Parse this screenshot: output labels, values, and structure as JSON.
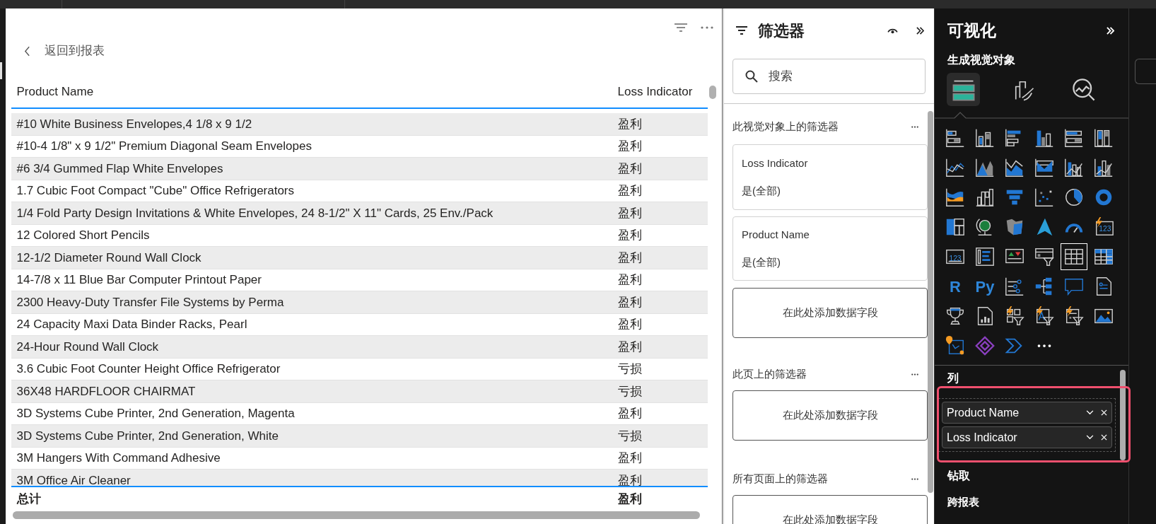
{
  "report": {
    "back_label": "返回到报表",
    "columns": [
      "Product Name",
      "Loss Indicator"
    ],
    "rows": [
      {
        "product": "#10 White Business Envelopes,4 1/8 x 9 1/2",
        "indicator": "盈利"
      },
      {
        "product": "#10-4 1/8\" x 9 1/2\" Premium Diagonal Seam Envelopes",
        "indicator": "盈利"
      },
      {
        "product": "#6 3/4 Gummed Flap White Envelopes",
        "indicator": "盈利"
      },
      {
        "product": "1.7 Cubic Foot Compact \"Cube\" Office Refrigerators",
        "indicator": "盈利"
      },
      {
        "product": "1/4 Fold Party Design Invitations & White Envelopes, 24 8-1/2\" X 11\" Cards, 25 Env./Pack",
        "indicator": "盈利"
      },
      {
        "product": "12 Colored Short Pencils",
        "indicator": "盈利"
      },
      {
        "product": "12-1/2 Diameter Round Wall Clock",
        "indicator": "盈利"
      },
      {
        "product": "14-7/8 x 11 Blue Bar Computer Printout Paper",
        "indicator": "盈利"
      },
      {
        "product": "2300 Heavy-Duty Transfer File Systems by Perma",
        "indicator": "盈利"
      },
      {
        "product": "24 Capacity Maxi Data Binder Racks, Pearl",
        "indicator": "盈利"
      },
      {
        "product": "24-Hour Round Wall Clock",
        "indicator": "盈利"
      },
      {
        "product": "3.6 Cubic Foot Counter Height Office Refrigerator",
        "indicator": "亏损"
      },
      {
        "product": "36X48 HARDFLOOR CHAIRMAT",
        "indicator": "亏损"
      },
      {
        "product": "3D Systems Cube Printer, 2nd Generation, Magenta",
        "indicator": "盈利"
      },
      {
        "product": "3D Systems Cube Printer, 2nd Generation, White",
        "indicator": "亏损"
      },
      {
        "product": "3M Hangers With Command Adhesive",
        "indicator": "盈利"
      },
      {
        "product": "3M Office Air Cleaner",
        "indicator": "盈利"
      }
    ],
    "total": {
      "label": "总计",
      "value": "盈利"
    }
  },
  "filters": {
    "title": "筛选器",
    "search": {
      "placeholder": "搜索"
    },
    "sections": [
      {
        "title": "此视觉对象上的筛选器",
        "cards": [
          {
            "field": "Loss Indicator",
            "value": "是(全部)"
          },
          {
            "field": "Product Name",
            "value": "是(全部)"
          }
        ],
        "add_label": "在此处添加数据字段"
      },
      {
        "title": "此页上的筛选器",
        "add_label": "在此处添加数据字段"
      },
      {
        "title": "所有页面上的筛选器",
        "add_label": "在此处添加数据字段"
      }
    ]
  },
  "visualizations": {
    "title": "可视化",
    "subtitle": "生成视觉对象",
    "tabs": [
      {
        "kind": "build",
        "selected": true
      },
      {
        "kind": "format",
        "selected": false
      },
      {
        "kind": "analytics",
        "selected": false
      }
    ],
    "gallery": [
      {
        "kind": "stacked-bar",
        "selected": false
      },
      {
        "kind": "stacked-column",
        "selected": false
      },
      {
        "kind": "clustered-bar",
        "selected": false
      },
      {
        "kind": "clustered-column",
        "selected": false
      },
      {
        "kind": "percent-bar",
        "selected": false
      },
      {
        "kind": "percent-column",
        "selected": false
      },
      {
        "kind": "line",
        "selected": false
      },
      {
        "kind": "area",
        "selected": false
      },
      {
        "kind": "stacked-area",
        "selected": false
      },
      {
        "kind": "ribbon-area",
        "selected": false
      },
      {
        "kind": "line-column",
        "selected": false
      },
      {
        "kind": "line-stacked-column",
        "selected": false
      },
      {
        "kind": "ribbon",
        "selected": false
      },
      {
        "kind": "waterfall",
        "selected": false
      },
      {
        "kind": "funnel",
        "selected": false
      },
      {
        "kind": "scatter",
        "selected": false
      },
      {
        "kind": "pie",
        "selected": false
      },
      {
        "kind": "donut",
        "selected": false
      },
      {
        "kind": "treemap",
        "selected": false
      },
      {
        "kind": "globe",
        "selected": false
      },
      {
        "kind": "filled-map",
        "selected": false
      },
      {
        "kind": "arrow",
        "selected": false
      },
      {
        "kind": "gauge",
        "selected": false
      },
      {
        "kind": "card-bolt",
        "glyph": "123",
        "selected": false
      },
      {
        "kind": "card",
        "glyph": "123",
        "selected": false
      },
      {
        "kind": "multi-card",
        "selected": false
      },
      {
        "kind": "kpi",
        "selected": false
      },
      {
        "kind": "slicer",
        "selected": false
      },
      {
        "kind": "table",
        "selected": true
      },
      {
        "kind": "matrix",
        "selected": false
      },
      {
        "kind": "script",
        "glyph": "R",
        "selected": false
      },
      {
        "kind": "script",
        "glyph": "Py",
        "selected": false
      },
      {
        "kind": "influencers",
        "selected": false
      },
      {
        "kind": "decomposition",
        "selected": false
      },
      {
        "kind": "qa",
        "selected": false
      },
      {
        "kind": "narrative",
        "selected": false
      },
      {
        "kind": "trophy",
        "selected": false
      },
      {
        "kind": "paginated",
        "selected": false
      },
      {
        "kind": "bolt-slicer",
        "selected": false
      },
      {
        "kind": "bolt-text-slicer",
        "selected": false
      },
      {
        "kind": "bolt-list-slicer",
        "selected": false
      },
      {
        "kind": "image",
        "selected": false
      },
      {
        "kind": "pin-map",
        "selected": false
      },
      {
        "kind": "apps",
        "selected": false
      },
      {
        "kind": "automate",
        "selected": false
      },
      {
        "kind": "more",
        "selected": false
      }
    ],
    "columns_well": {
      "title": "列",
      "fields": [
        "Product Name",
        "Loss Indicator"
      ]
    },
    "drill": {
      "title": "钻取",
      "cross_report_label": "跨报表"
    }
  }
}
